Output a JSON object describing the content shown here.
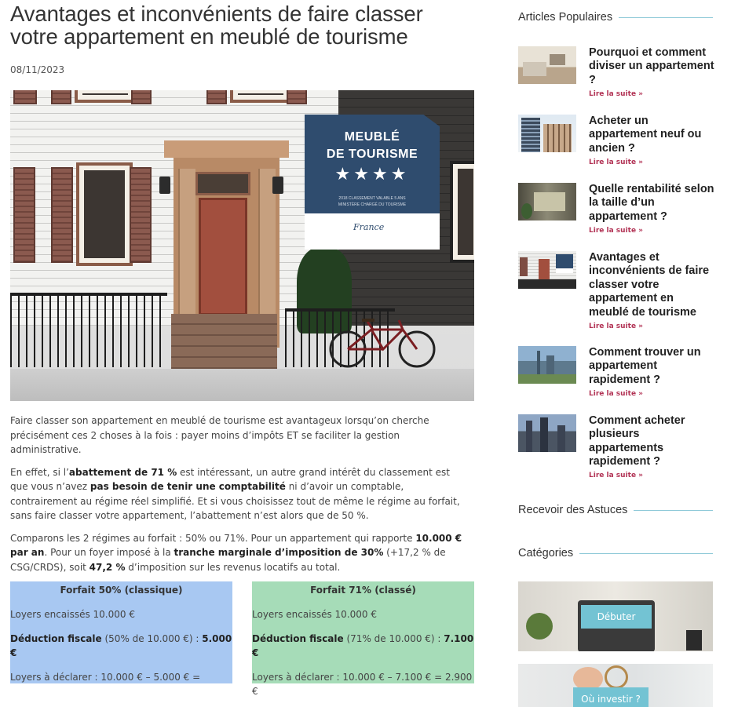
{
  "article": {
    "title": "Avantages et inconvénients de faire classer votre appartement en meublé de tourisme",
    "date": "08/11/2023",
    "hero_sign": {
      "line1": "MEUBLÉ",
      "line2": "DE TOURISME",
      "stars": "★★★★",
      "small1": "2018 CLASSEMENT VALABLE 5 ANS",
      "small2": "MINISTÈRE CHARGÉ DU TOURISME",
      "logo": "France"
    },
    "p1": "Faire classer son appartement en meublé de tourisme est avantageux lorsqu’on cherche précisément ces 2 choses à la fois : payer moins d’impôts ET se faciliter la gestion administrative.",
    "p2": {
      "a": "En effet, si l’",
      "b": "abattement de 71 %",
      "c": " est intéressant, un autre grand intérêt du classement est que vous n’avez ",
      "d": "pas besoin de tenir une comptabilité",
      "e": " ni d’avoir un comptable, contrairement au régime réel simplifié. Et si vous choisissez tout de même le régime au forfait, sans faire classer votre appartement, l’abattement n’est alors que de 50 %."
    },
    "p3": {
      "a": "Comparons les 2 régimes au forfait : 50% ou 71%. Pour un appartement qui rapporte ",
      "b": "10.000 € par an",
      "c": ". Pour un foyer imposé à la ",
      "d": "tranche marginale d’imposition de 30%",
      "e": " (+17,2 % de CSG/CRDS), soit ",
      "f": "47,2 %",
      "g": " d’imposition sur les revenus locatifs au total."
    },
    "box_left": {
      "heading": "Forfait 50% (classique)",
      "line1": "Loyers encaissés 10.000 €",
      "line2_b": "Déduction fiscale",
      "line2": " (50% de 10.000 €) : ",
      "line2_v": "5.000 €",
      "line3": "Loyers à déclarer : 10.000 € – 5.000 € ="
    },
    "box_right": {
      "heading": "Forfait 71% (classé)",
      "line1": "Loyers encaissés 10.000 €",
      "line2_b": "Déduction fiscale",
      "line2": " (71% de 10.000 €) : ",
      "line2_v": "7.100 €",
      "line3": "Loyers à déclarer : 10.000 € – 7.100 € = 2.900 €"
    }
  },
  "sidebar": {
    "popular_heading": "Articles Populaires",
    "read_more": "Lire la suite »",
    "articles": [
      {
        "title": "Pourquoi et comment diviser un appartement ?"
      },
      {
        "title": "Acheter un appartement neuf ou ancien ?"
      },
      {
        "title": "Quelle rentabilité selon la taille d’un appartement ?"
      },
      {
        "title": "Avantages et inconvénients de faire classer votre appartement en meublé de tourisme"
      },
      {
        "title": "Comment trouver un appartement rapidement ?"
      },
      {
        "title": "Comment acheter plusieurs appartements rapidement ?"
      }
    ],
    "newsletter_heading": "Recevoir des Astuces",
    "categories_heading": "Catégories",
    "categories": [
      {
        "label": "Débuter"
      },
      {
        "label": "Où investir ?"
      }
    ]
  },
  "colors": {
    "accent_line": "#8ec9d8",
    "read_more": "#b23355",
    "box_left": "#a8c8f2",
    "box_right": "#a6dcb8",
    "category_button": "#73c3d3"
  }
}
